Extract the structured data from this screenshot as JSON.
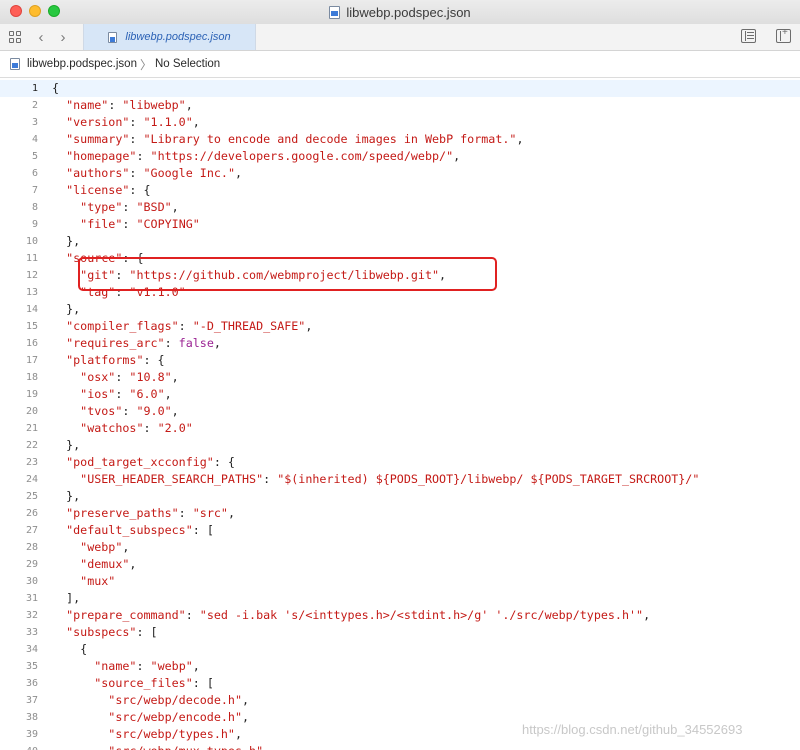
{
  "window": {
    "title": "libwebp.podspec.json",
    "file_icon": "json-document-icon"
  },
  "tabbar": {
    "active_tab": "libwebp.podspec.json",
    "back_icon": "chevron-left-icon",
    "forward_icon": "chevron-right-icon",
    "grid_icon": "related-items-grid-icon",
    "lines_icon": "editor-options-lines-icon",
    "add_editor_icon": "add-editor-icon"
  },
  "jumpbar": {
    "file": "libwebp.podspec.json",
    "separator": "〉",
    "selection": "No Selection"
  },
  "editor": {
    "current_line": 1,
    "lines": [
      [
        {
          "c": "p",
          "t": "{"
        }
      ],
      [
        {
          "c": "p",
          "t": "  "
        },
        {
          "c": "s",
          "t": "\"name\""
        },
        {
          "c": "p",
          "t": ": "
        },
        {
          "c": "s",
          "t": "\"libwebp\""
        },
        {
          "c": "p",
          "t": ","
        }
      ],
      [
        {
          "c": "p",
          "t": "  "
        },
        {
          "c": "s",
          "t": "\"version\""
        },
        {
          "c": "p",
          "t": ": "
        },
        {
          "c": "s",
          "t": "\"1.1.0\""
        },
        {
          "c": "p",
          "t": ","
        }
      ],
      [
        {
          "c": "p",
          "t": "  "
        },
        {
          "c": "s",
          "t": "\"summary\""
        },
        {
          "c": "p",
          "t": ": "
        },
        {
          "c": "s",
          "t": "\"Library to encode and decode images in WebP format.\""
        },
        {
          "c": "p",
          "t": ","
        }
      ],
      [
        {
          "c": "p",
          "t": "  "
        },
        {
          "c": "s",
          "t": "\"homepage\""
        },
        {
          "c": "p",
          "t": ": "
        },
        {
          "c": "s",
          "t": "\"https://developers.google.com/speed/webp/\""
        },
        {
          "c": "p",
          "t": ","
        }
      ],
      [
        {
          "c": "p",
          "t": "  "
        },
        {
          "c": "s",
          "t": "\"authors\""
        },
        {
          "c": "p",
          "t": ": "
        },
        {
          "c": "s",
          "t": "\"Google Inc.\""
        },
        {
          "c": "p",
          "t": ","
        }
      ],
      [
        {
          "c": "p",
          "t": "  "
        },
        {
          "c": "s",
          "t": "\"license\""
        },
        {
          "c": "p",
          "t": ": {"
        }
      ],
      [
        {
          "c": "p",
          "t": "    "
        },
        {
          "c": "s",
          "t": "\"type\""
        },
        {
          "c": "p",
          "t": ": "
        },
        {
          "c": "s",
          "t": "\"BSD\""
        },
        {
          "c": "p",
          "t": ","
        }
      ],
      [
        {
          "c": "p",
          "t": "    "
        },
        {
          "c": "s",
          "t": "\"file\""
        },
        {
          "c": "p",
          "t": ": "
        },
        {
          "c": "s",
          "t": "\"COPYING\""
        }
      ],
      [
        {
          "c": "p",
          "t": "  },"
        }
      ],
      [
        {
          "c": "p",
          "t": "  "
        },
        {
          "c": "s",
          "t": "\"source\""
        },
        {
          "c": "p",
          "t": ": {"
        }
      ],
      [
        {
          "c": "p",
          "t": "    "
        },
        {
          "c": "s",
          "t": "\"git\""
        },
        {
          "c": "p",
          "t": ": "
        },
        {
          "c": "s",
          "t": "\"https://github.com/webmproject/libwebp.git\""
        },
        {
          "c": "p",
          "t": ","
        }
      ],
      [
        {
          "c": "p",
          "t": "    "
        },
        {
          "c": "s",
          "t": "\"tag\""
        },
        {
          "c": "p",
          "t": ": "
        },
        {
          "c": "s",
          "t": "\"v1.1.0\""
        }
      ],
      [
        {
          "c": "p",
          "t": "  },"
        }
      ],
      [
        {
          "c": "p",
          "t": "  "
        },
        {
          "c": "s",
          "t": "\"compiler_flags\""
        },
        {
          "c": "p",
          "t": ": "
        },
        {
          "c": "s",
          "t": "\"-D_THREAD_SAFE\""
        },
        {
          "c": "p",
          "t": ","
        }
      ],
      [
        {
          "c": "p",
          "t": "  "
        },
        {
          "c": "s",
          "t": "\"requires_arc\""
        },
        {
          "c": "p",
          "t": ": "
        },
        {
          "c": "k",
          "t": "false"
        },
        {
          "c": "p",
          "t": ","
        }
      ],
      [
        {
          "c": "p",
          "t": "  "
        },
        {
          "c": "s",
          "t": "\"platforms\""
        },
        {
          "c": "p",
          "t": ": {"
        }
      ],
      [
        {
          "c": "p",
          "t": "    "
        },
        {
          "c": "s",
          "t": "\"osx\""
        },
        {
          "c": "p",
          "t": ": "
        },
        {
          "c": "s",
          "t": "\"10.8\""
        },
        {
          "c": "p",
          "t": ","
        }
      ],
      [
        {
          "c": "p",
          "t": "    "
        },
        {
          "c": "s",
          "t": "\"ios\""
        },
        {
          "c": "p",
          "t": ": "
        },
        {
          "c": "s",
          "t": "\"6.0\""
        },
        {
          "c": "p",
          "t": ","
        }
      ],
      [
        {
          "c": "p",
          "t": "    "
        },
        {
          "c": "s",
          "t": "\"tvos\""
        },
        {
          "c": "p",
          "t": ": "
        },
        {
          "c": "s",
          "t": "\"9.0\""
        },
        {
          "c": "p",
          "t": ","
        }
      ],
      [
        {
          "c": "p",
          "t": "    "
        },
        {
          "c": "s",
          "t": "\"watchos\""
        },
        {
          "c": "p",
          "t": ": "
        },
        {
          "c": "s",
          "t": "\"2.0\""
        }
      ],
      [
        {
          "c": "p",
          "t": "  },"
        }
      ],
      [
        {
          "c": "p",
          "t": "  "
        },
        {
          "c": "s",
          "t": "\"pod_target_xcconfig\""
        },
        {
          "c": "p",
          "t": ": {"
        }
      ],
      [
        {
          "c": "p",
          "t": "    "
        },
        {
          "c": "s",
          "t": "\"USER_HEADER_SEARCH_PATHS\""
        },
        {
          "c": "p",
          "t": ": "
        },
        {
          "c": "s",
          "t": "\"$(inherited) ${PODS_ROOT}/libwebp/ ${PODS_TARGET_SRCROOT}/\""
        }
      ],
      [
        {
          "c": "p",
          "t": "  },"
        }
      ],
      [
        {
          "c": "p",
          "t": "  "
        },
        {
          "c": "s",
          "t": "\"preserve_paths\""
        },
        {
          "c": "p",
          "t": ": "
        },
        {
          "c": "s",
          "t": "\"src\""
        },
        {
          "c": "p",
          "t": ","
        }
      ],
      [
        {
          "c": "p",
          "t": "  "
        },
        {
          "c": "s",
          "t": "\"default_subspecs\""
        },
        {
          "c": "p",
          "t": ": ["
        }
      ],
      [
        {
          "c": "p",
          "t": "    "
        },
        {
          "c": "s",
          "t": "\"webp\""
        },
        {
          "c": "p",
          "t": ","
        }
      ],
      [
        {
          "c": "p",
          "t": "    "
        },
        {
          "c": "s",
          "t": "\"demux\""
        },
        {
          "c": "p",
          "t": ","
        }
      ],
      [
        {
          "c": "p",
          "t": "    "
        },
        {
          "c": "s",
          "t": "\"mux\""
        }
      ],
      [
        {
          "c": "p",
          "t": "  ],"
        }
      ],
      [
        {
          "c": "p",
          "t": "  "
        },
        {
          "c": "s",
          "t": "\"prepare_command\""
        },
        {
          "c": "p",
          "t": ": "
        },
        {
          "c": "s",
          "t": "\"sed -i.bak 's/<inttypes.h>/<stdint.h>/g' './src/webp/types.h'\""
        },
        {
          "c": "p",
          "t": ","
        }
      ],
      [
        {
          "c": "p",
          "t": "  "
        },
        {
          "c": "s",
          "t": "\"subspecs\""
        },
        {
          "c": "p",
          "t": ": ["
        }
      ],
      [
        {
          "c": "p",
          "t": "    {"
        }
      ],
      [
        {
          "c": "p",
          "t": "      "
        },
        {
          "c": "s",
          "t": "\"name\""
        },
        {
          "c": "p",
          "t": ": "
        },
        {
          "c": "s",
          "t": "\"webp\""
        },
        {
          "c": "p",
          "t": ","
        }
      ],
      [
        {
          "c": "p",
          "t": "      "
        },
        {
          "c": "s",
          "t": "\"source_files\""
        },
        {
          "c": "p",
          "t": ": ["
        }
      ],
      [
        {
          "c": "p",
          "t": "        "
        },
        {
          "c": "s",
          "t": "\"src/webp/decode.h\""
        },
        {
          "c": "p",
          "t": ","
        }
      ],
      [
        {
          "c": "p",
          "t": "        "
        },
        {
          "c": "s",
          "t": "\"src/webp/encode.h\""
        },
        {
          "c": "p",
          "t": ","
        }
      ],
      [
        {
          "c": "p",
          "t": "        "
        },
        {
          "c": "s",
          "t": "\"src/webp/types.h\""
        },
        {
          "c": "p",
          "t": ","
        }
      ],
      [
        {
          "c": "p",
          "t": "        "
        },
        {
          "c": "s",
          "t": "\"src/webp/mux_types.h\""
        },
        {
          "c": "p",
          "t": ","
        }
      ]
    ]
  },
  "annotation": {
    "color": "#e02121",
    "highlighted_line": 12
  },
  "watermark": {
    "text": "https://blog.csdn.net/github_34552693"
  },
  "colors": {
    "string": "#c41a16",
    "keyword": "#9b2393",
    "current_line_bg": "#ecf5ff",
    "active_tab_bg": "#d7e6f7",
    "active_tab_text": "#2b61b5"
  }
}
